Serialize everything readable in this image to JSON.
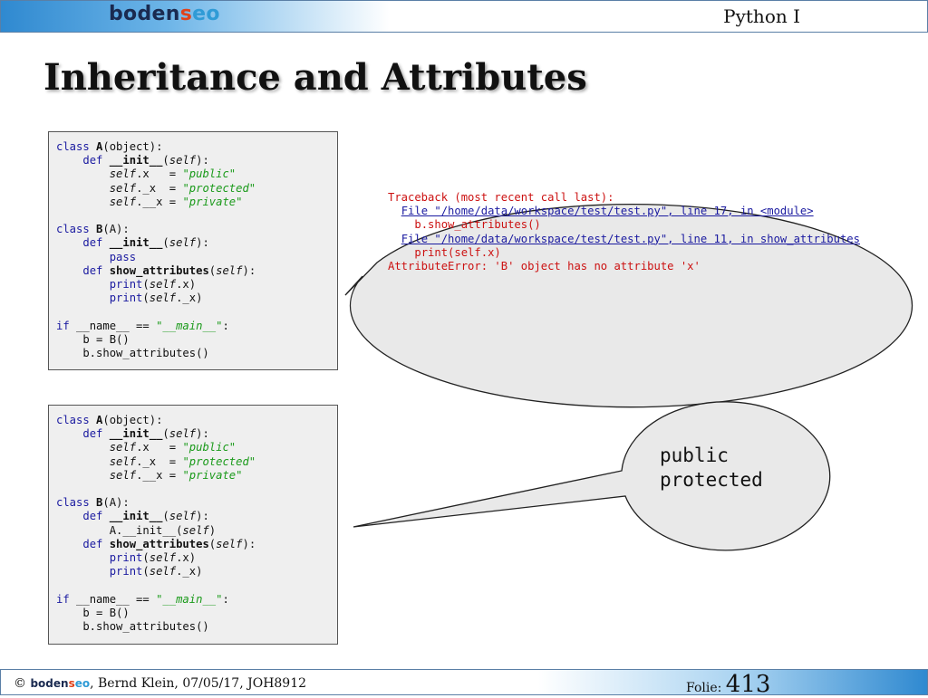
{
  "header": {
    "logo": {
      "part1": "boden",
      "part2": "s",
      "part3": "eo"
    },
    "course": "Python I"
  },
  "slide": {
    "title": "Inheritance and Attributes"
  },
  "bubble1": {
    "traceback_header": "Traceback (most recent call last):",
    "file_line_1": "File \"/home/data/workspace/test/test.py\", line 17, in <module>",
    "code_line_1": "b.show_attributes()",
    "file_line_2": "File \"/home/data/workspace/test/test.py\", line 11, in show_attributes",
    "code_line_2": "print(self.x)",
    "error": "AttributeError: 'B' object has no attribute 'x'"
  },
  "bubble2": {
    "output": [
      "public",
      "protected"
    ]
  },
  "footer": {
    "copyright": "©",
    "logo": {
      "part1": "boden",
      "part2": "s",
      "part3": "eo"
    },
    "author": ", Bernd Klein, 07/05/17, JOH8912",
    "folie_label": "Folie:",
    "folie_number": "413"
  },
  "colors": {
    "keyword": "#1a1aa0",
    "string": "#1a9a1a",
    "error": "#cc1111",
    "header_gradient": "#2f89d0",
    "code_background": "#efefef",
    "bubble_fill": "#e9e9e9"
  }
}
